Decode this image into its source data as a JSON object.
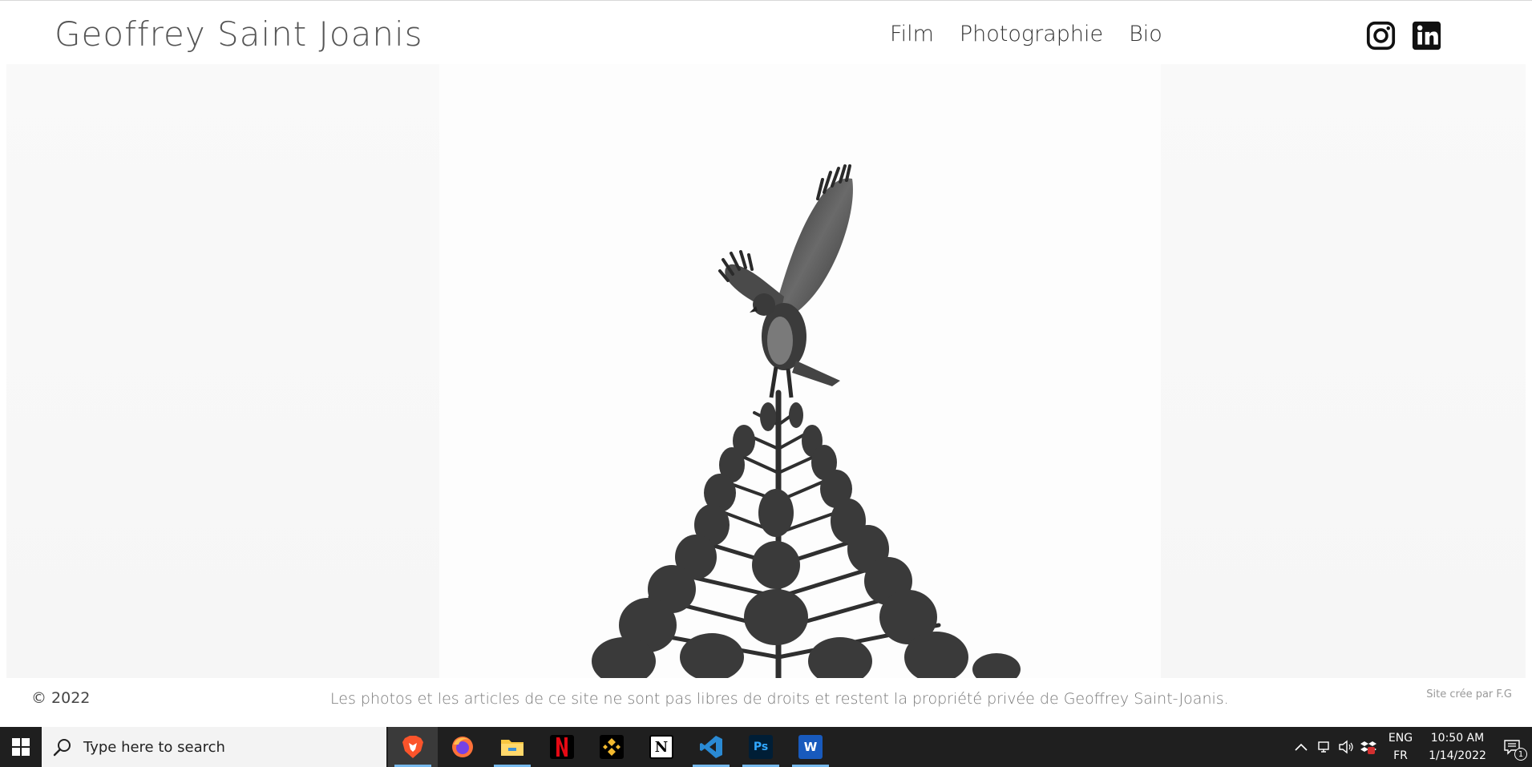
{
  "header": {
    "site_title": "Geoffrey Saint Joanis",
    "nav": [
      {
        "label": "Film"
      },
      {
        "label": "Photographie"
      },
      {
        "label": "Bio"
      }
    ],
    "socials": [
      {
        "icon": "instagram-icon"
      },
      {
        "icon": "linkedin-icon"
      }
    ]
  },
  "hero": {
    "subject": "hawk-landing-on-fir-tree",
    "tone": "black-and-white"
  },
  "footer": {
    "copyright": "© 2022",
    "rights": "Les photos et les articles de ce site ne sont pas libres de droits et restent la propriété privée de Geoffrey Saint-Joanis.",
    "credit": "Site crée par F.G"
  },
  "taskbar": {
    "search_placeholder": "Type here to search",
    "apps": [
      {
        "name": "brave-icon",
        "active": true
      },
      {
        "name": "firefox-icon",
        "active": false
      },
      {
        "name": "file-explorer-icon",
        "active": false,
        "underline": true
      },
      {
        "name": "netflix-icon",
        "active": false
      },
      {
        "name": "binance-icon",
        "active": false
      },
      {
        "name": "notion-icon",
        "active": false
      },
      {
        "name": "vscode-icon",
        "active": false,
        "underline": true
      },
      {
        "name": "photoshop-icon",
        "active": false,
        "underline": true,
        "label": "Ps"
      },
      {
        "name": "word-icon",
        "active": false,
        "underline": true,
        "label": "W"
      }
    ],
    "language": {
      "line1": "ENG",
      "line2": "FR"
    },
    "clock": {
      "time": "10:50 AM",
      "date": "1/14/2022"
    },
    "notification_count": "1"
  },
  "colors": {
    "taskbar_bg": "#1f1f1f",
    "accent_blue": "#76b9ed",
    "netflix_red": "#e50914",
    "binance_yellow": "#f3ba2f",
    "vscode_blue": "#2a8ad4",
    "photoshop_bg": "#001e36",
    "word_blue": "#185abd"
  }
}
